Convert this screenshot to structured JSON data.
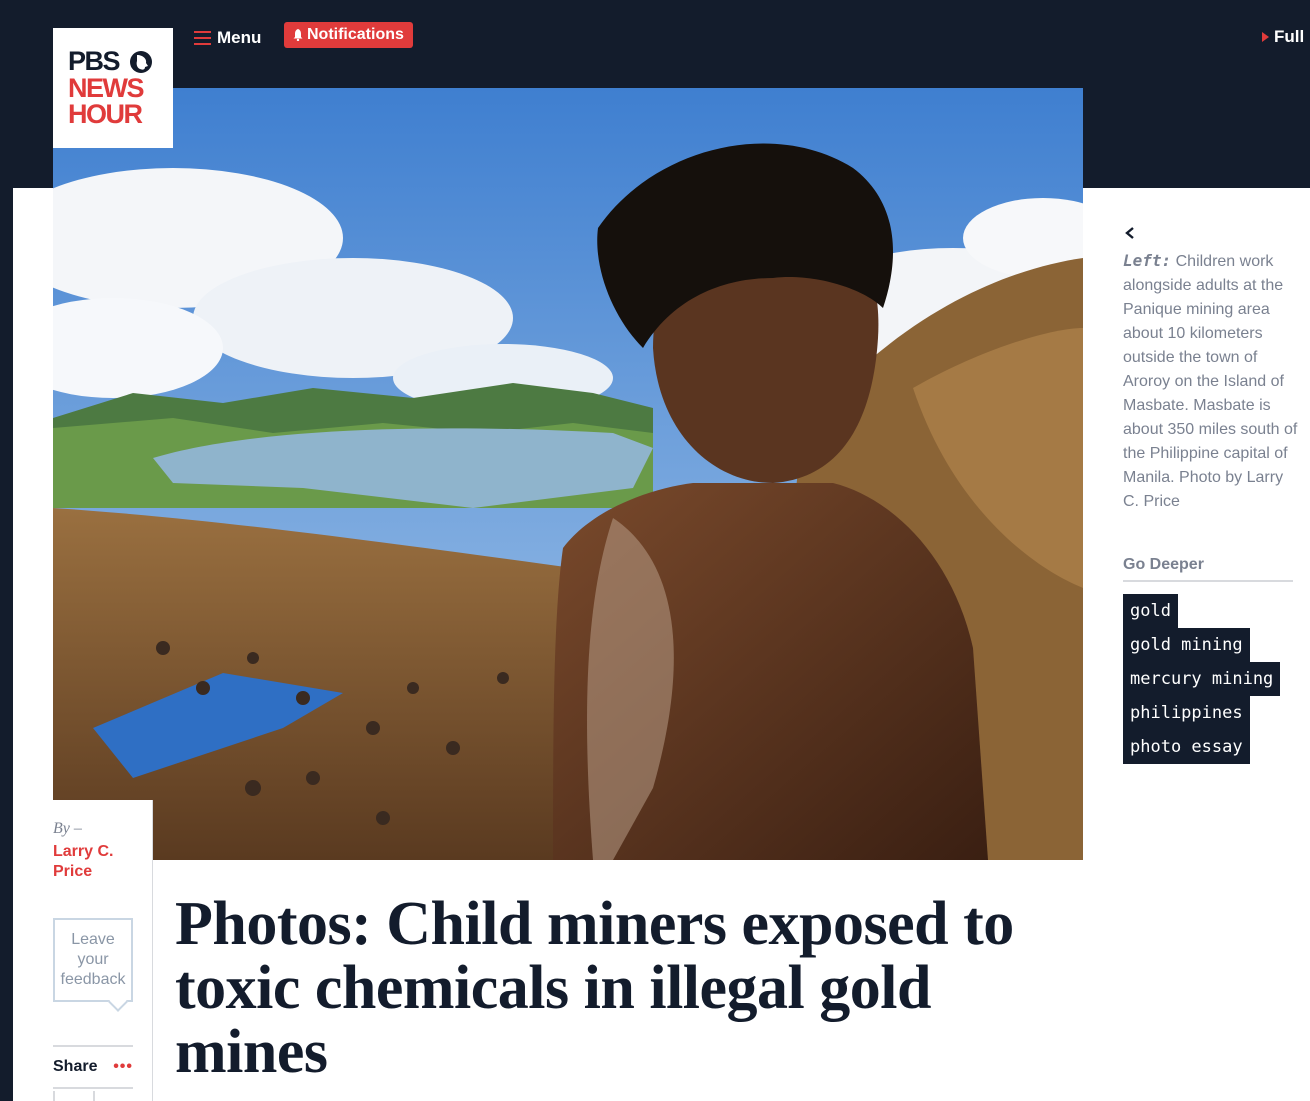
{
  "header": {
    "logo": {
      "line1": "PBS",
      "line2": "NEWS",
      "line3": "HOUR"
    },
    "menu_label": "Menu",
    "notifications_label": "Notifications",
    "full_label": "Full"
  },
  "hero": {
    "alt": "Boy overlooking a gold mining site near a lake"
  },
  "byline": {
    "by_label": "By –",
    "author": "Larry C. Price",
    "feedback_label": "Leave your feedback",
    "share_label": "Share",
    "share_more": "•••"
  },
  "article": {
    "headline": "Photos: Child miners exposed to toxic chemicals in illegal gold mines"
  },
  "sidebar": {
    "caption_direction": "Left:",
    "caption_text": " Children work alongside adults at the Panique mining area about 10 kilometers outside the town of Aroroy on the Island of Masbate. Masbate is about 350 miles south of the Philippine capital of Manila. Photo by Larry C. Price",
    "go_deeper_label": "Go Deeper",
    "tags": [
      "gold",
      "gold mining",
      "mercury mining",
      "philippines",
      "photo essay"
    ]
  },
  "colors": {
    "navy": "#131c2c",
    "accent_red": "#e03b3b",
    "muted_text": "#7a8190"
  }
}
